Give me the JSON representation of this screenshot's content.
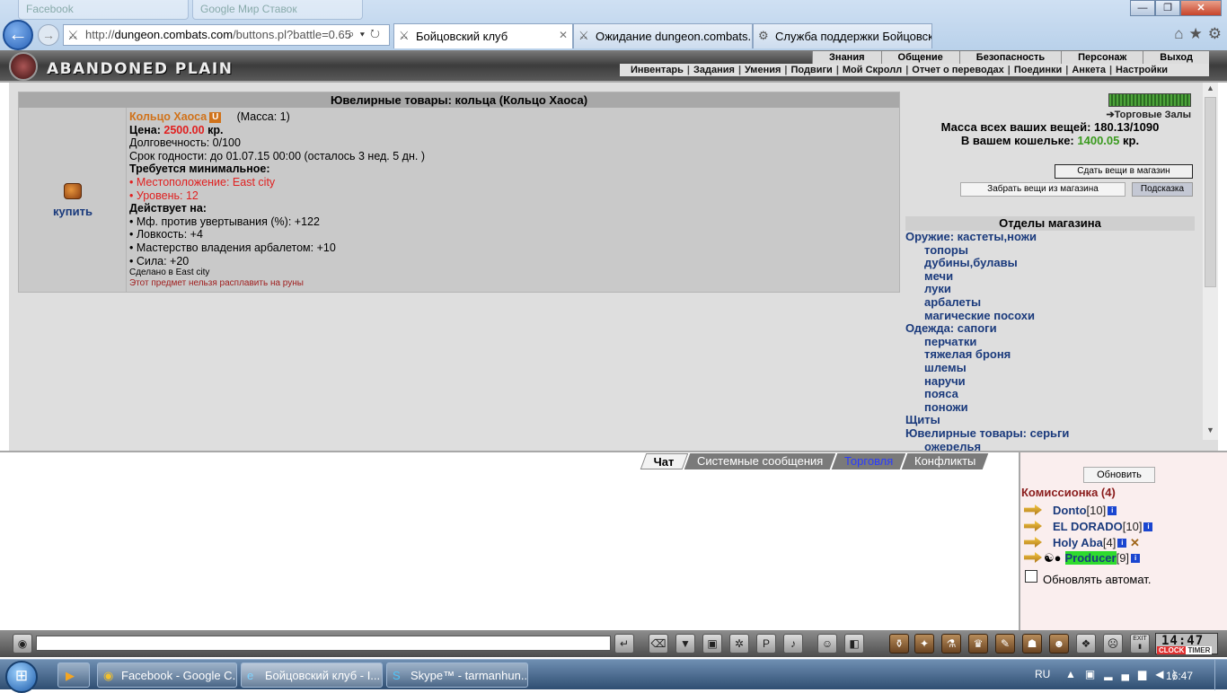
{
  "browser": {
    "ghost_tabs": [
      "Facebook",
      "Google Мир Ставок"
    ],
    "window_buttons": {
      "minimize": "—",
      "maximize": "❐",
      "close": "✕"
    },
    "url_prefix": "http://",
    "url_host": "dungeon.combats.com",
    "url_path": "/buttons.pl?battle=0.65",
    "tabs": [
      {
        "label": "Бойцовский клуб"
      },
      {
        "label": "Ожидание dungeon.combats...."
      },
      {
        "label": "Служба поддержки Бойцовск..."
      }
    ]
  },
  "game": {
    "title": "ABANDONED PLAIN",
    "top_menu": [
      "Знания",
      "Общение",
      "Безопасность",
      "Персонаж",
      "Выход"
    ],
    "sub_menu": [
      "Инвентарь",
      "Задания",
      "Умения",
      "Подвиги",
      "Мой Скролл",
      "Отчет о переводах",
      "Поединки",
      "Анкета",
      "Настройки"
    ]
  },
  "item": {
    "header": "Ювелирные товары: кольца (Кольцо Хаоса)",
    "buy_label": "купить",
    "name": "Кольцо Хаоса",
    "badge": "U",
    "mass": "(Масса: 1)",
    "price_label": "Цена:",
    "price_value": "2500.00",
    "price_unit": "кр.",
    "durability": "Долговечность: 0/100",
    "expiry": "Срок годности: до 01.07.15 00:00 (осталось 3 нед. 5 дн. )",
    "requires_title": "Требуется минимальное:",
    "requirements": [
      "• Местоположение: East city",
      "• Уровень: 12"
    ],
    "effects_title": "Действует на:",
    "effects": [
      "• Мф. против увертывания (%): +122",
      "• Ловкость: +4",
      "• Мастерство владения арбалетом: +10",
      "• Сила: +20"
    ],
    "made_in": "Сделано в East city",
    "no_runes": "Этот предмет нельзя расплавить на руны"
  },
  "shop": {
    "halls_link": "Торговые Залы",
    "mass_line": "Масса всех ваших вещей: 180.13/1090",
    "wallet_label": "В вашем кошельке:",
    "wallet_value": "1400.05",
    "wallet_unit": "кр.",
    "give_button": "Сдать вещи в магазин",
    "take_button": "Забрать вещи из магазина",
    "hint_button": "Подсказка",
    "departments_title": "Отделы магазина",
    "departments": [
      {
        "label": "Оружие: кастеты,ножи",
        "sub": false
      },
      {
        "label": "топоры",
        "sub": true
      },
      {
        "label": "дубины,булавы",
        "sub": true
      },
      {
        "label": "мечи",
        "sub": true
      },
      {
        "label": "луки",
        "sub": true
      },
      {
        "label": "арбалеты",
        "sub": true
      },
      {
        "label": "магические посохи",
        "sub": true
      },
      {
        "label": "Одежда: сапоги",
        "sub": false
      },
      {
        "label": "перчатки",
        "sub": true
      },
      {
        "label": "тяжелая броня",
        "sub": true
      },
      {
        "label": "шлемы",
        "sub": true
      },
      {
        "label": "наручи",
        "sub": true
      },
      {
        "label": "пояса",
        "sub": true
      },
      {
        "label": "поножи",
        "sub": true
      },
      {
        "label": "Щиты",
        "sub": false
      },
      {
        "label": "Ювелирные товары: серьги",
        "sub": false
      },
      {
        "label": "ожерелья",
        "sub": true
      }
    ]
  },
  "chat": {
    "tabs": [
      "Чат",
      "Системные сообщения",
      "Торговля",
      "Конфликты"
    ]
  },
  "online": {
    "refresh_button": "Обновить",
    "room": "Комиссионка (4)",
    "users": [
      {
        "name": "Donto",
        "level": "[10]"
      },
      {
        "name": "EL DORADO",
        "level": "[10]"
      },
      {
        "name": "Holy Aba",
        "level": "[4]"
      },
      {
        "name": "Producer",
        "level": "[9]"
      }
    ],
    "auto_refresh_label": "Обновлять автомат."
  },
  "toolbar": {
    "clock_time": "14:47",
    "clock_label": "CLOCK",
    "timer_label": "TIMER",
    "exit_label": "EXIT"
  },
  "taskbar": {
    "items": [
      "Facebook - Google C...",
      "Бойцовский клуб - I...",
      "Skype™ - tarmanhun..."
    ],
    "lang": "RU",
    "time": "16:47"
  }
}
